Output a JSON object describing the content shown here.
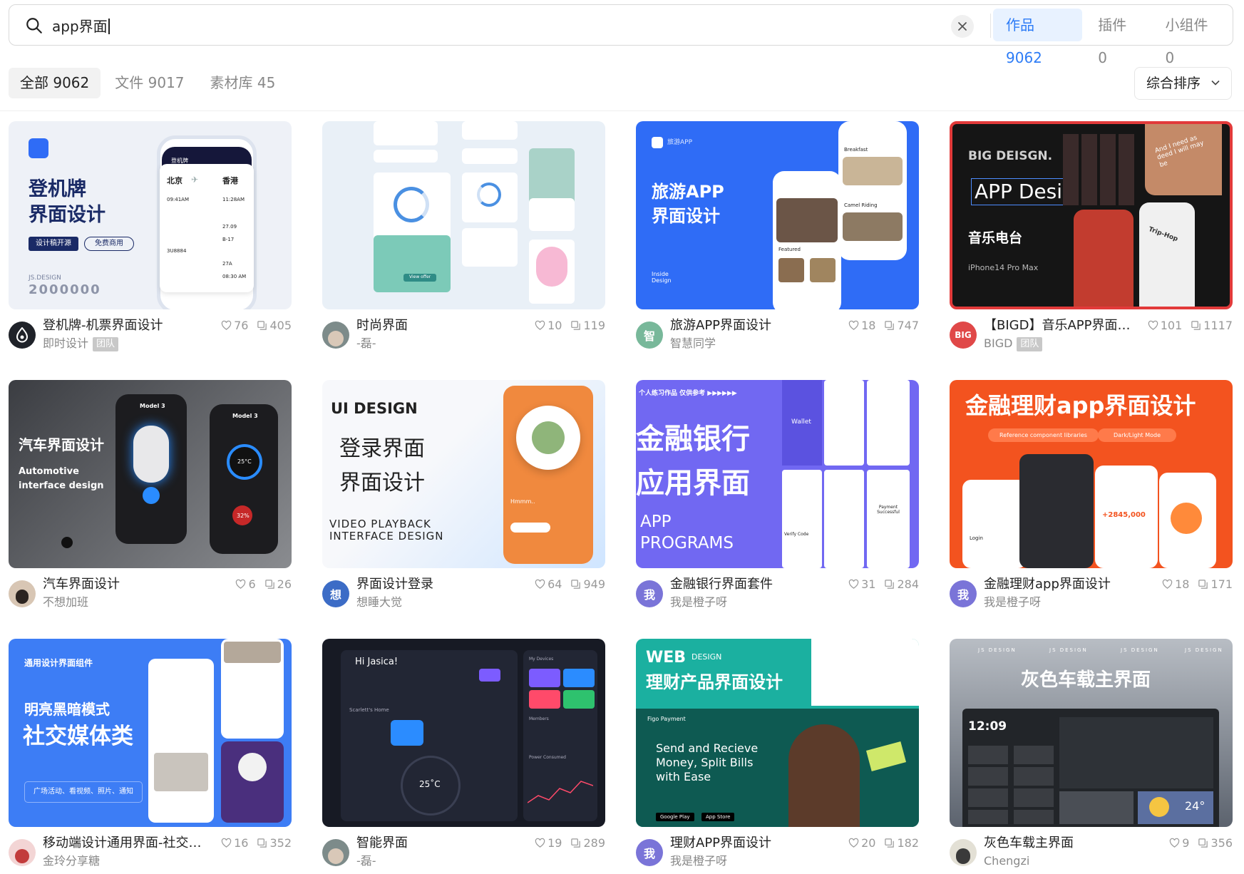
{
  "search": {
    "query": "app界面",
    "tabs": [
      {
        "label": "作品",
        "count": "9062"
      },
      {
        "label": "插件",
        "count": "0"
      },
      {
        "label": "小组件",
        "count": "0"
      }
    ]
  },
  "filters": {
    "tabs": [
      {
        "label": "全部",
        "count": "9062"
      },
      {
        "label": "文件",
        "count": "9017"
      },
      {
        "label": "素材库",
        "count": "45"
      }
    ],
    "sort_label": "综合排序"
  },
  "cards": [
    {
      "title": "登机牌-机票界面设计",
      "author": "即时设计",
      "badge": "团队",
      "likes": "76",
      "copies": "405",
      "thumb": {
        "title_l1": "登机牌",
        "title_l2": "界面设计",
        "btn1": "设计稿开源",
        "btn2": "免费商用",
        "brand": "JS.DESIGN",
        "brand_num": "2000000",
        "bar": "登机牌",
        "from_city": "北京",
        "to_city": "香港",
        "t1": "09:41AM",
        "t2": "11:28AM",
        "r1a": "27.09",
        "r1b": "B-17",
        "r2a": "27A",
        "r2b": "08:30 AM",
        "code": "3U8884"
      }
    },
    {
      "title": "时尚界面",
      "author": "-磊-",
      "badge": "",
      "likes": "10",
      "copies": "119",
      "thumb": {
        "button": "View offer"
      }
    },
    {
      "title": "旅游APP界面设计",
      "author": "智慧同学",
      "badge": "",
      "likes": "18",
      "copies": "747",
      "avatar_text": "智",
      "thumb": {
        "app": "旅游APP",
        "title_l1": "旅游APP",
        "title_l2": "界面设计",
        "footer": "Inside Design",
        "s1": "Breakfast",
        "s2": "Camel Riding",
        "s3": "Featured"
      }
    },
    {
      "title": "【BIGD】音乐APP界面设计",
      "author": "BIGD",
      "badge": "团队",
      "likes": "101",
      "copies": "1117",
      "avatar_text": "BIG",
      "thumb": {
        "brand": "BIG DEISGN.",
        "headline": "APP Design",
        "sub": "音乐电台",
        "device": "iPhone14  Pro Max",
        "note": "And I need as deed I will may be",
        "trip": "Trip-Hop"
      }
    },
    {
      "title": "汽车界面设计",
      "author": "不想加班",
      "badge": "",
      "likes": "6",
      "copies": "26",
      "thumb": {
        "title": "汽车界面设计",
        "sub1": "Automotive",
        "sub2": "interface design",
        "model1": "Model 3",
        "model2": "Model 3",
        "temp": "25°C",
        "pct": "32%"
      }
    },
    {
      "title": "界面设计登录",
      "author": "想睡大觉",
      "badge": "",
      "likes": "64",
      "copies": "949",
      "avatar_text": "想",
      "thumb": {
        "title": "UI DESIGN",
        "l1": "登录界面",
        "l2": "界面设计",
        "s1": "VIDEO PLAYBACK",
        "s2": "INTERFACE DESIGN",
        "food": "Hmmm.."
      }
    },
    {
      "title": "金融银行界面套件",
      "author": "我是橙子呀",
      "badge": "",
      "likes": "31",
      "copies": "284",
      "avatar_text": "我",
      "thumb": {
        "tag": "个人练习作品  仅供参考  ▶▶▶▶▶▶",
        "l1": "金融银行",
        "l2": "应用界面",
        "s1": "APP",
        "s2": "PROGRAMS",
        "wallet": "Wallet",
        "verify": "Verify Code",
        "pay": "Payment Successful"
      }
    },
    {
      "title": "金融理财app界面设计",
      "author": "我是橙子呀",
      "badge": "",
      "likes": "18",
      "copies": "171",
      "avatar_text": "我",
      "thumb": {
        "title": "金融理财app界面设计",
        "pill1": "Reference component libraries",
        "pill2": "Dark/Light Mode",
        "amount": "+2845,000",
        "login": "Login"
      }
    },
    {
      "title": "移动端设计通用界面-社交媒体类",
      "author": "金玲分享糖",
      "badge": "",
      "likes": "16",
      "copies": "352",
      "thumb": {
        "tag": "通用设计界面组件",
        "l1": "明亮黑暗模式",
        "l2": "社交媒体类",
        "pill": "广场活动、看视频、照片、通知"
      }
    },
    {
      "title": "智能界面",
      "author": "-磊-",
      "badge": "",
      "likes": "19",
      "copies": "289",
      "thumb": {
        "greet": "Hi Jasica!",
        "home": "Scarlett's Home",
        "temp": "25˚C",
        "devices": "My Devices",
        "members": "Members",
        "power": "Power Consumed"
      }
    },
    {
      "title": "理财APP界面设计",
      "author": "我是橙子呀",
      "badge": "",
      "likes": "20",
      "copies": "182",
      "avatar_text": "我",
      "thumb": {
        "web": "WEB",
        "design": "DESIGN",
        "title": "理财产品界面设计",
        "pay": "Figo Payment",
        "headline": "Send and Recieve Money, Split Bills with Ease",
        "gp": "Google Play",
        "as": "App Store"
      }
    },
    {
      "title": "灰色车载主界面",
      "author": "Chengzi",
      "badge": "",
      "likes": "9",
      "copies": "356",
      "thumb": {
        "brand": "JS DESIGN",
        "title": "灰色车载主界面",
        "time": "12:09",
        "temp": "24°"
      }
    }
  ],
  "colors": {
    "accent": "#2d7cf6",
    "accent_bg": "#e8f2ff"
  }
}
